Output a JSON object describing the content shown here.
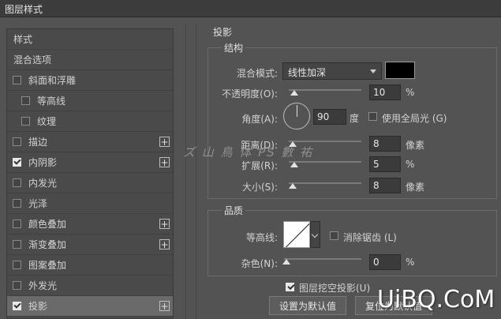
{
  "window": {
    "title": "图层样式"
  },
  "sidebar": {
    "items": [
      {
        "label": "样式",
        "type": "header"
      },
      {
        "label": "混合选项",
        "type": "header"
      },
      {
        "label": "斜面和浮雕",
        "checkbox": true,
        "checked": false
      },
      {
        "label": "等高线",
        "checkbox": true,
        "checked": false,
        "sub": true
      },
      {
        "label": "纹理",
        "checkbox": true,
        "checked": false,
        "sub": true
      },
      {
        "label": "描边",
        "checkbox": true,
        "checked": false,
        "plus": true
      },
      {
        "label": "内阴影",
        "checkbox": true,
        "checked": true,
        "plus": true
      },
      {
        "label": "内发光",
        "checkbox": true,
        "checked": false
      },
      {
        "label": "光泽",
        "checkbox": true,
        "checked": false
      },
      {
        "label": "颜色叠加",
        "checkbox": true,
        "checked": false,
        "plus": true
      },
      {
        "label": "渐变叠加",
        "checkbox": true,
        "checked": false,
        "plus": true
      },
      {
        "label": "图案叠加",
        "checkbox": true,
        "checked": false
      },
      {
        "label": "外发光",
        "checkbox": true,
        "checked": false
      },
      {
        "label": "投影",
        "checkbox": true,
        "checked": true,
        "plus": true,
        "selected": true
      }
    ]
  },
  "panel": {
    "title": "投影",
    "structure": {
      "group_title": "结构",
      "blend_mode_label": "混合模式:",
      "blend_mode_value": "线性加深",
      "color": "#000000",
      "opacity_label": "不透明度(O):",
      "opacity_value": "10",
      "opacity_unit": "%",
      "angle_label": "角度(A):",
      "angle_value": "90",
      "angle_unit": "度",
      "global_light_label": "使用全局光 (G)",
      "global_light_checked": false,
      "distance_label": "距离(D):",
      "distance_value": "8",
      "distance_unit": "像素",
      "spread_label": "扩展(R):",
      "spread_value": "5",
      "spread_unit": "%",
      "size_label": "大小(S):",
      "size_value": "8",
      "size_unit": "像素"
    },
    "quality": {
      "group_title": "品质",
      "contour_label": "等高线:",
      "antialias_label": "消除锯齿 (L)",
      "antialias_checked": false,
      "noise_label": "杂色(N):",
      "noise_value": "0",
      "noise_unit": "%"
    },
    "knockout_label": "图层挖空投影(U)",
    "knockout_checked": true,
    "set_default_label": "设置为默认值",
    "reset_default_label": "复位为默认值"
  },
  "overlay": {
    "watermark_text": "ズ 山 鳥 体 PS 數 祐",
    "logo_text": "UiBQ.CoM"
  }
}
